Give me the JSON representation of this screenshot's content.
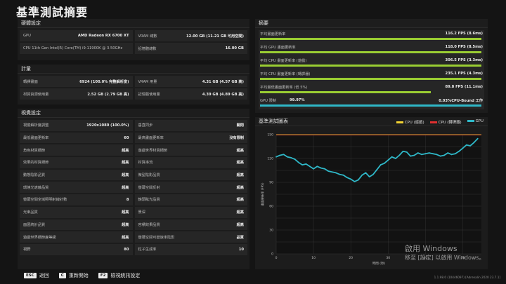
{
  "page": {
    "title": "基準測試摘要"
  },
  "hardware": {
    "header": "硬體設定",
    "rows": [
      {
        "label": "GPU",
        "value": "AMD Radeon RX 6700 XT"
      },
      {
        "label": "VRAM 總數",
        "value": "12.00 GB (11.21 GB 可用空間)"
      },
      {
        "label": "CPU 11th Gen Intel(R) Core(TM) i9-11900K @ 3.50GHz",
        "value": ""
      },
      {
        "label": "記憶體總數",
        "value": "16.00 GB"
      }
    ]
  },
  "metrics": {
    "header": "計量",
    "rows": [
      {
        "label": "轉譯畫面",
        "value": "6924 (100.0% 完整解析度)"
      },
      {
        "label": "VRAM 用量",
        "value": "4.31 GB (4.57 GB 高)"
      },
      {
        "label": "材質資源使用量",
        "value": "2.52 GB (2.79 GB 高)"
      },
      {
        "label": "記憶體使用量",
        "value": "4.39 GB (4.89 GB 高)"
      }
    ]
  },
  "visual": {
    "header": "視覺設定",
    "rows": [
      {
        "label": "視窗解析度調整",
        "value": "1920x1080 (100.0%)"
      },
      {
        "label": "垂直同步",
        "value": "關閉"
      },
      {
        "label": "最低畫面更新率",
        "value": "60"
      },
      {
        "label": "最高畫面更新率",
        "value": "沒有限制"
      },
      {
        "label": "角色材質細節",
        "value": "超高"
      },
      {
        "label": "遊戲世界材質細節",
        "value": "超高"
      },
      {
        "label": "效果的材質細節",
        "value": "超高"
      },
      {
        "label": "材質串流",
        "value": "超高"
      },
      {
        "label": "動態陰影品質",
        "value": "超高"
      },
      {
        "label": "微型陰影品質",
        "value": "超高"
      },
      {
        "label": "環境光遮蔽品質",
        "value": "超高"
      },
      {
        "label": "螢幕空間反射",
        "value": "超高"
      },
      {
        "label": "螢幕空間全域照明射線計數",
        "value": "8"
      },
      {
        "label": "鏡頭眩光品質",
        "value": "超高"
      },
      {
        "label": "光束品質",
        "value": "超高"
      },
      {
        "label": "景深",
        "value": "超高"
      },
      {
        "label": "面匯統計品質",
        "value": "超高"
      },
      {
        "label": "容積效果品質",
        "value": "超高"
      },
      {
        "label": "遊戲世界細節度等級",
        "value": "超高"
      },
      {
        "label": "螢幕空間可變速率陰影",
        "value": "品質"
      },
      {
        "label": "視野",
        "value": "80"
      },
      {
        "label": "粒子生成率",
        "value": "10"
      }
    ]
  },
  "summary": {
    "header": "摘要",
    "rows": [
      {
        "label": "平均畫面更新率",
        "value": "116.2 FPS (8.6ms)",
        "bar": 1.0
      },
      {
        "label": "平均 GPU 畫面更新率",
        "value": "118.0 FPS (8.5ms)",
        "bar": 1.0
      },
      {
        "label": "平均 CPU 畫面更新率 (遊戲)",
        "value": "306.5 FPS (3.3ms)",
        "bar": 1.0
      },
      {
        "label": "平均 CPU 畫面更新率 (轉譯器)",
        "value": "235.1 FPS (4.3ms)",
        "bar": 1.0
      },
      {
        "label": "平均最低畫面更新率 (低 5%)",
        "value": "89.8 FPS (11.1ms)",
        "bar": 0.77
      }
    ],
    "gpu_limit": {
      "label": "GPU 限制",
      "value": "99.97%",
      "right": "0.03%CPU-Bound 工作",
      "bar": 0.9997
    }
  },
  "chart_data": {
    "type": "line",
    "title": "基準測試圖表",
    "xlabel": "時間 (秒)",
    "ylabel": "畫面更新率 (FPS)",
    "xlim": [
      0,
      55
    ],
    "ylim": [
      0,
      150
    ],
    "xticks": [
      0,
      10,
      20,
      30,
      40,
      50
    ],
    "yticks": [
      0,
      15,
      30,
      45,
      60,
      75,
      90,
      105,
      120,
      135,
      150
    ],
    "ytick_labels": {
      "0": "0",
      "30": "30",
      "60": "60",
      "90": "90",
      "120": "120",
      "150": "150"
    },
    "series": [
      {
        "name": "CPU (遊戲)",
        "color": "#f2d233",
        "values": [
          150,
          150
        ]
      },
      {
        "name": "CPU (轉譯器)",
        "color": "#e03030",
        "values": [
          150,
          150
        ]
      },
      {
        "name": "GPU",
        "color": "#2fb8c8",
        "x": [
          0,
          1,
          2,
          3,
          4,
          5,
          6,
          7,
          8,
          9,
          10,
          11,
          12,
          13,
          14,
          15,
          16,
          17,
          18,
          19,
          20,
          21,
          22,
          23,
          24,
          25,
          26,
          27,
          28,
          29,
          30,
          31,
          32,
          33,
          34,
          35,
          36,
          37,
          38,
          39,
          40,
          41,
          42,
          43,
          44,
          45,
          46,
          47,
          48,
          49,
          50,
          51,
          52,
          53,
          54
        ],
        "values": [
          122,
          124,
          125,
          122,
          121,
          119,
          115,
          112,
          113,
          110,
          107,
          110,
          108,
          107,
          104,
          103,
          102,
          100,
          99,
          96,
          94,
          91,
          93,
          99,
          102,
          97,
          100,
          106,
          112,
          114,
          118,
          122,
          120,
          124,
          129,
          128,
          123,
          124,
          127,
          125,
          126,
          127,
          126,
          125,
          123,
          124,
          127,
          125,
          126,
          129,
          133,
          137,
          136,
          140,
          145
        ]
      }
    ]
  },
  "footer": {
    "items": [
      {
        "key": "ESC",
        "label": "返回"
      },
      {
        "key": "C",
        "label": "重新開始"
      },
      {
        "key": "F2",
        "label": "檢視統訊設定"
      }
    ],
    "version": "1.1.98.0 (10446097) [Adrenalin 2020 23.7.1]",
    "watermark_line1": "啟用 Windows",
    "watermark_line2": "移至 [設定] 以啟用 Windows。"
  }
}
